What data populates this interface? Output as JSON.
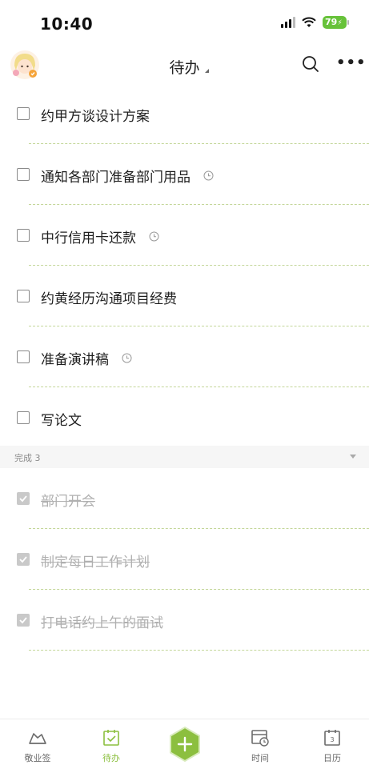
{
  "status": {
    "time": "10:40",
    "battery": "79"
  },
  "header": {
    "title": "待办"
  },
  "tasks": [
    {
      "title": "约甲方谈设计方案",
      "has_reminder": false
    },
    {
      "title": "通知各部门准备部门用品",
      "has_reminder": true
    },
    {
      "title": "中行信用卡还款",
      "has_reminder": true
    },
    {
      "title": "约黄经历沟通项目经费",
      "has_reminder": false
    },
    {
      "title": "准备演讲稿",
      "has_reminder": true
    },
    {
      "title": "写论文",
      "has_reminder": false
    }
  ],
  "done_section": {
    "label": "完成 3"
  },
  "done_tasks": [
    {
      "title": "部门开会"
    },
    {
      "title": "制定每日工作计划"
    },
    {
      "title": "打电话约上午的面试"
    }
  ],
  "tabbar": {
    "items": [
      {
        "label": "敬业签",
        "icon": "note-icon"
      },
      {
        "label": "待办",
        "icon": "todo-icon"
      },
      {
        "label": "",
        "icon": "add-icon"
      },
      {
        "label": "时间",
        "icon": "time-icon"
      },
      {
        "label": "日历",
        "icon": "calendar-icon",
        "calendar_day": "3"
      }
    ]
  },
  "colors": {
    "accent": "#8cbf3f",
    "battery": "#67c23a",
    "divider": "#c4d79a",
    "done_text": "#b0b0b0"
  }
}
